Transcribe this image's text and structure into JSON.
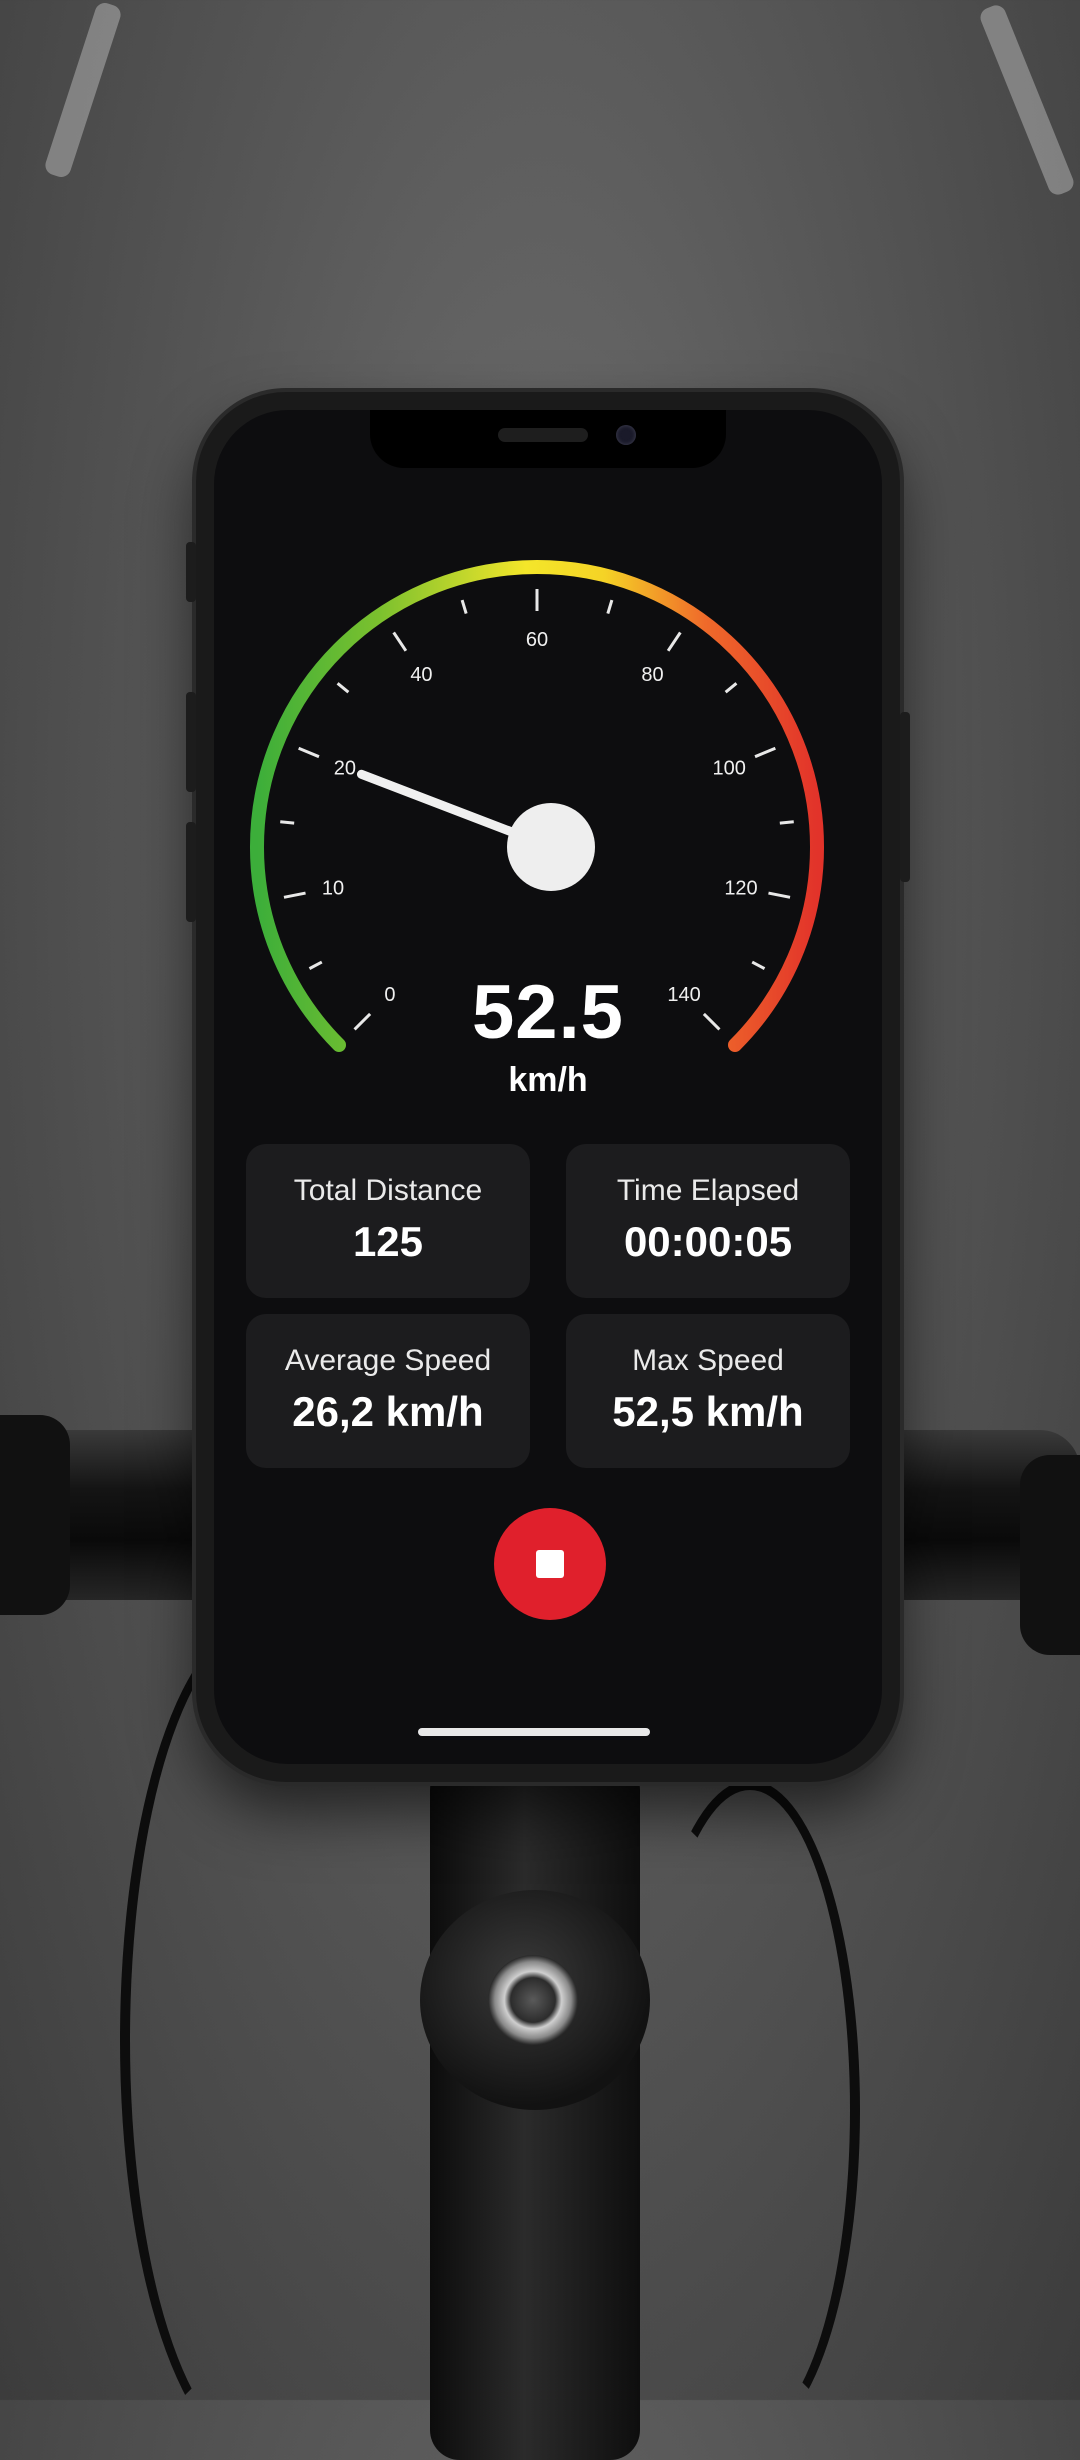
{
  "speedometer": {
    "tick_labels": [
      "0",
      "10",
      "20",
      "40",
      "60",
      "80",
      "100",
      "120",
      "140"
    ],
    "needle_value_scale": 0.25,
    "colors": {
      "low": "#3cae3a",
      "mid": "#f4e62a",
      "high": "#e2332a"
    }
  },
  "speed": {
    "value": "52.5",
    "unit": "km/h"
  },
  "stats": [
    {
      "label": "Total Distance",
      "value": "125"
    },
    {
      "label": "Time Elapsed",
      "value": "00:00:05"
    },
    {
      "label": "Average Speed",
      "value": "26,2 km/h"
    },
    {
      "label": "Max Speed",
      "value": "52,5 km/h"
    }
  ],
  "controls": {
    "stop_icon": "stop-icon",
    "stop_color": "#e0202c"
  }
}
